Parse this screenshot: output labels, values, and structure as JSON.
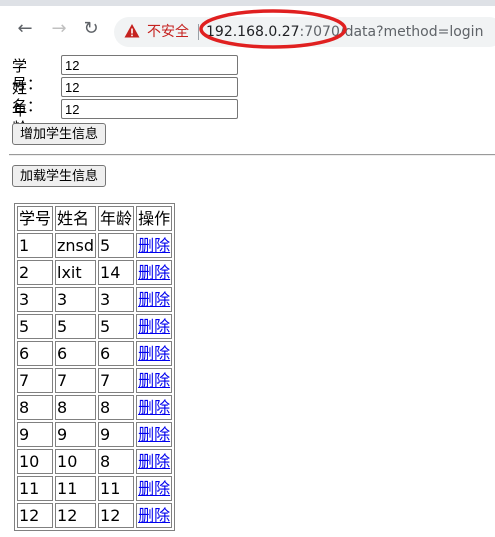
{
  "browser": {
    "not_secure_label": "不安全",
    "url_host": "192.168.0.27",
    "url_rest": ":7070/data?method=login",
    "annotation_color": "#e02020"
  },
  "form": {
    "fields": [
      {
        "label": "学号：",
        "value": "12"
      },
      {
        "label": "姓名：",
        "value": "12"
      },
      {
        "label": "年龄：",
        "value": "12"
      }
    ],
    "add_button": "增加学生信息",
    "load_button": "加载学生信息"
  },
  "table": {
    "headers": [
      "学号",
      "姓名",
      "年龄",
      "操作"
    ],
    "delete_label": "删除",
    "rows": [
      {
        "id": "1",
        "name": "znsd",
        "age": "5"
      },
      {
        "id": "2",
        "name": "lxit",
        "age": "14"
      },
      {
        "id": "3",
        "name": "3",
        "age": "3"
      },
      {
        "id": "5",
        "name": "5",
        "age": "5"
      },
      {
        "id": "6",
        "name": "6",
        "age": "6"
      },
      {
        "id": "7",
        "name": "7",
        "age": "7"
      },
      {
        "id": "8",
        "name": "8",
        "age": "8"
      },
      {
        "id": "9",
        "name": "9",
        "age": "9"
      },
      {
        "id": "10",
        "name": "10",
        "age": "8"
      },
      {
        "id": "11",
        "name": "11",
        "age": "11"
      },
      {
        "id": "12",
        "name": "12",
        "age": "12"
      }
    ]
  }
}
